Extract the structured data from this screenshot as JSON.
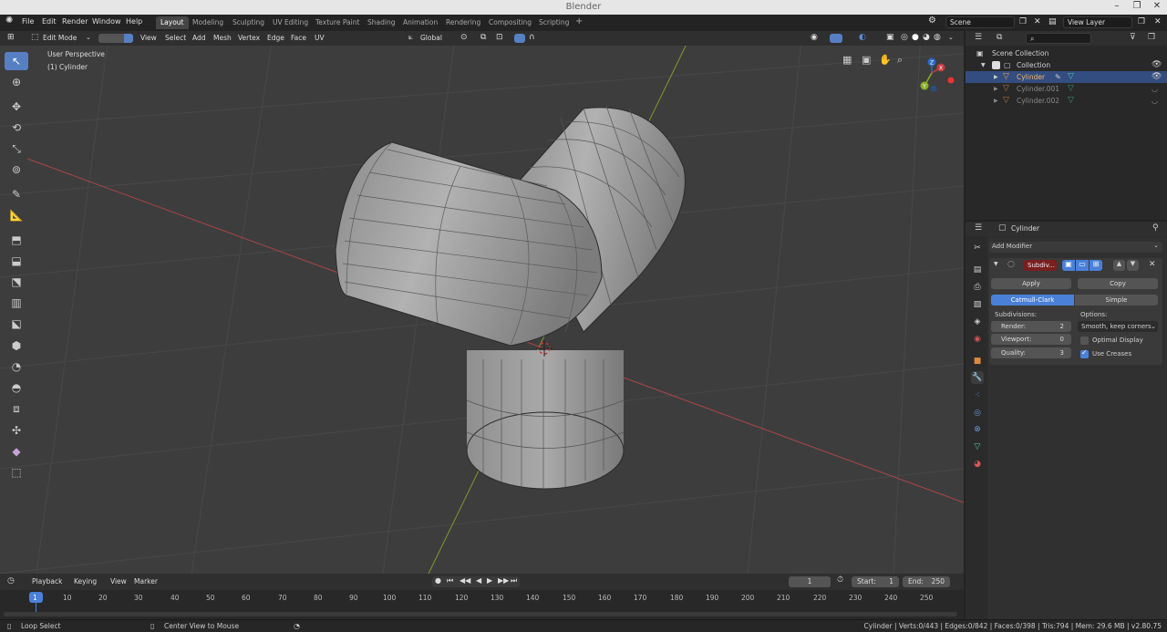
{
  "app": {
    "title": "Blender"
  },
  "menus": [
    "File",
    "Edit",
    "Render",
    "Window",
    "Help"
  ],
  "workspaces": [
    "Layout",
    "Modeling",
    "Sculpting",
    "UV Editing",
    "Texture Paint",
    "Shading",
    "Animation",
    "Rendering",
    "Compositing",
    "Scripting"
  ],
  "active_workspace": "Layout",
  "add_workspace": "+",
  "scene": "Scene",
  "view_layer": "View Layer",
  "viewport": {
    "mode": "Edit Mode",
    "header_menus": [
      "View",
      "Select",
      "Add",
      "Mesh",
      "Vertex",
      "Edge",
      "Face",
      "UV"
    ],
    "transform_orientation": "Global",
    "perspective": "User Perspective",
    "object": "(1) Cylinder",
    "gizmo_axes": {
      "x": "X",
      "y": "Y",
      "z": "Z"
    }
  },
  "outliner": {
    "search_placeholder": "",
    "scene_collection": "Scene Collection",
    "collection": "Collection",
    "objects": [
      {
        "name": "Cylinder",
        "selected": true
      },
      {
        "name": "Cylinder.001",
        "selected": false
      },
      {
        "name": "Cylinder.002",
        "selected": false
      }
    ]
  },
  "properties": {
    "object": "Cylinder",
    "add_modifier": "Add Modifier",
    "modifier_name": "Subdiv...",
    "apply": "Apply",
    "copy": "Copy",
    "catmull": "Catmull-Clark",
    "simple": "Simple",
    "subdivisions_label": "Subdivisions:",
    "options_label": "Options:",
    "render_label": "Render:",
    "render_value": "2",
    "viewport_label": "Viewport:",
    "viewport_value": "0",
    "quality_label": "Quality:",
    "quality_value": "3",
    "uv_smooth": "Smooth, keep corners",
    "optimal_display": "Optimal Display",
    "use_creases": "Use Creases"
  },
  "timeline": {
    "menus": [
      "Playback",
      "Keying",
      "View",
      "Marker"
    ],
    "current_frame": "1",
    "start_label": "Start:",
    "start": "1",
    "end_label": "End:",
    "end": "250",
    "ticks": [
      "1",
      "10",
      "20",
      "30",
      "40",
      "50",
      "60",
      "70",
      "80",
      "90",
      "100",
      "110",
      "120",
      "130",
      "140",
      "150",
      "160",
      "170",
      "180",
      "190",
      "200",
      "210",
      "220",
      "230",
      "240",
      "250"
    ]
  },
  "status": {
    "left_action": "Loop Select",
    "middle_action": "Center View to Mouse",
    "info": "Cylinder | Verts:0/443 | Edges:0/842 | Faces:0/398 | Tris:794 | Mem: 29.6 MB | v2.80.75"
  },
  "colors": {
    "accent": "#5680c2",
    "selected_row": "#334d80",
    "x_axis": "#c43c3c",
    "y_axis": "#8ab024",
    "z_axis": "#2d6bc7"
  }
}
